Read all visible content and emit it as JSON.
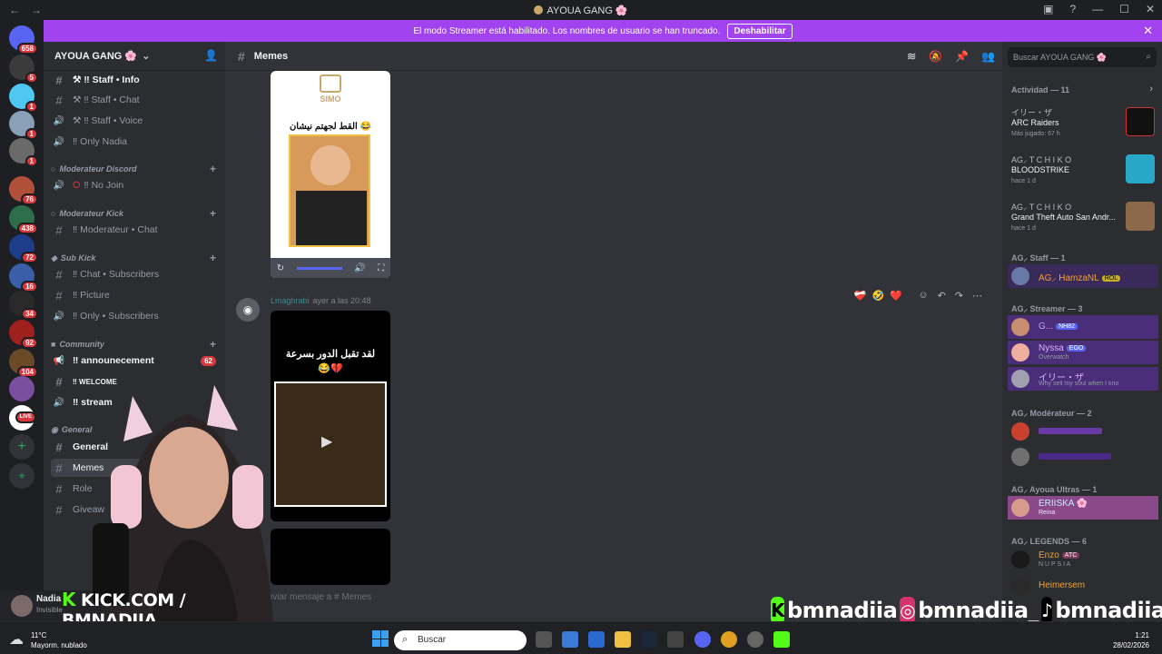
{
  "window": {
    "title": "AYOUA GANG 🌸",
    "nav_back": "←",
    "nav_forward": "→",
    "controls": [
      "▣",
      "?",
      "—",
      "☐",
      "✕"
    ]
  },
  "banner": {
    "text": "El modo Streamer está habilitado. Los nombres de usuario se han truncado.",
    "button": "Deshabilitar",
    "close": "✕"
  },
  "servers": [
    {
      "badge": "658"
    },
    {
      "badge": "5"
    },
    {
      "badge": "1"
    },
    {
      "badge": "1"
    },
    {
      "badge": "1"
    },
    {
      "badge": "76"
    },
    {
      "badge": "438"
    },
    {
      "badge": "72"
    },
    {
      "badge": "16"
    },
    {
      "badge": "34"
    },
    {
      "badge": "92"
    },
    {
      "badge": "104"
    },
    {
      "badge": ""
    },
    {
      "badge": "LIVE"
    }
  ],
  "server": {
    "name": "AYOUA GANG 🌸",
    "channels": [
      {
        "label": "⚒ ‼ Staff • Info",
        "icon": "#",
        "bold": true
      },
      {
        "label": "⚒ ‼ Staff • Chat",
        "icon": "#"
      },
      {
        "label": "⚒ ‼ Staff • Voice",
        "icon": "🔊"
      },
      {
        "label": "‼ Only Nadia",
        "icon": "🔊"
      }
    ],
    "cat_mod_discord": "Moderateur Discord",
    "ch_no_join": "‼ No Join",
    "cat_mod_kick": "Moderateur Kick",
    "ch_mod_chat": "‼ Moderateur • Chat",
    "cat_sub_kick": "Sub Kick",
    "ch_chat_subs": "‼ Chat • Subscribers",
    "ch_picture": "‼ Picture",
    "ch_only_subs": "‼ Only • Subscribers",
    "cat_community": "Community",
    "ch_announcement": "‼ announecement",
    "ch_announcement_badge": "62",
    "ch_welcome": "‼ WELCOME",
    "ch_stream": "‼ stream",
    "cat_general": "General",
    "ch_general": "General",
    "ch_memes": "Memes",
    "ch_roles": "Role",
    "ch_giveaway": "Giveaw"
  },
  "user": {
    "name": "Nadia",
    "status": "Invisible"
  },
  "chat": {
    "channel": "Memes",
    "post1": {
      "brand": "SIMO",
      "caption": "القط لجهتم نيشان 😂"
    },
    "post2": {
      "author": "Lmaghrabi",
      "time": "ayer a las 20:48",
      "caption": "لقد تقبل الدور بسرعة 😂💔",
      "reactions": [
        "❤️‍🩹",
        "🤣",
        "❤️"
      ]
    },
    "composer_placeholder": "Enviar mensaje a #",
    "composer_channel": "Memes"
  },
  "right": {
    "search_placeholder": "Buscar AYOUA GANG 🌸",
    "activity_title": "Actividad — 11",
    "activities": [
      {
        "user": "イリー・ザ",
        "game": "ARC Raiders",
        "sub": "Más jugado: 67 h"
      },
      {
        "user": "AG⸝ T C H I K O",
        "game": "BLOODSTRIKE",
        "sub": "hace 1 d"
      },
      {
        "user": "AG⸝ T C H I K O",
        "game": "Grand Theft Auto San Andr...",
        "sub": "hace 1 d"
      }
    ],
    "staff_title": "AG⸝ Staff — 1",
    "staff": [
      {
        "name": "AG⸝ HamzaNL",
        "tag": "ROL"
      }
    ],
    "streamer_title": "AG⸝ Streamer — 3",
    "streamers": [
      {
        "name": "G...",
        "tag": "NH82"
      },
      {
        "name": "Nyssa",
        "tag": "EGO",
        "status": "Overwatch"
      },
      {
        "name": "イリー・ザ",
        "status": "Why sell my soul when I kno"
      }
    ],
    "mod_title": "AG⸝ Modérateur — 2",
    "ultras_title": "AG⸝ Ayoua Ultras — 1",
    "ultras": [
      {
        "name": "ERIISKA 🌸",
        "status": "Reina"
      }
    ],
    "legends_title": "AG⸝ LEGENDS — 6",
    "legends": [
      {
        "name": "Enzo",
        "tag": "ATC",
        "status": "N U P S I A"
      },
      {
        "name": "Heimersem"
      }
    ]
  },
  "taskbar": {
    "temp": "11°C",
    "weather": "Mayorm. nublado",
    "search": "Buscar",
    "time": "1:21",
    "date": "28/02/2026"
  },
  "overlay": {
    "kick_text": "KICK.COM / BMNADIIA",
    "social1": "bmnadiia",
    "social2": "bmnadiia_",
    "social3": "bmnadiia"
  }
}
